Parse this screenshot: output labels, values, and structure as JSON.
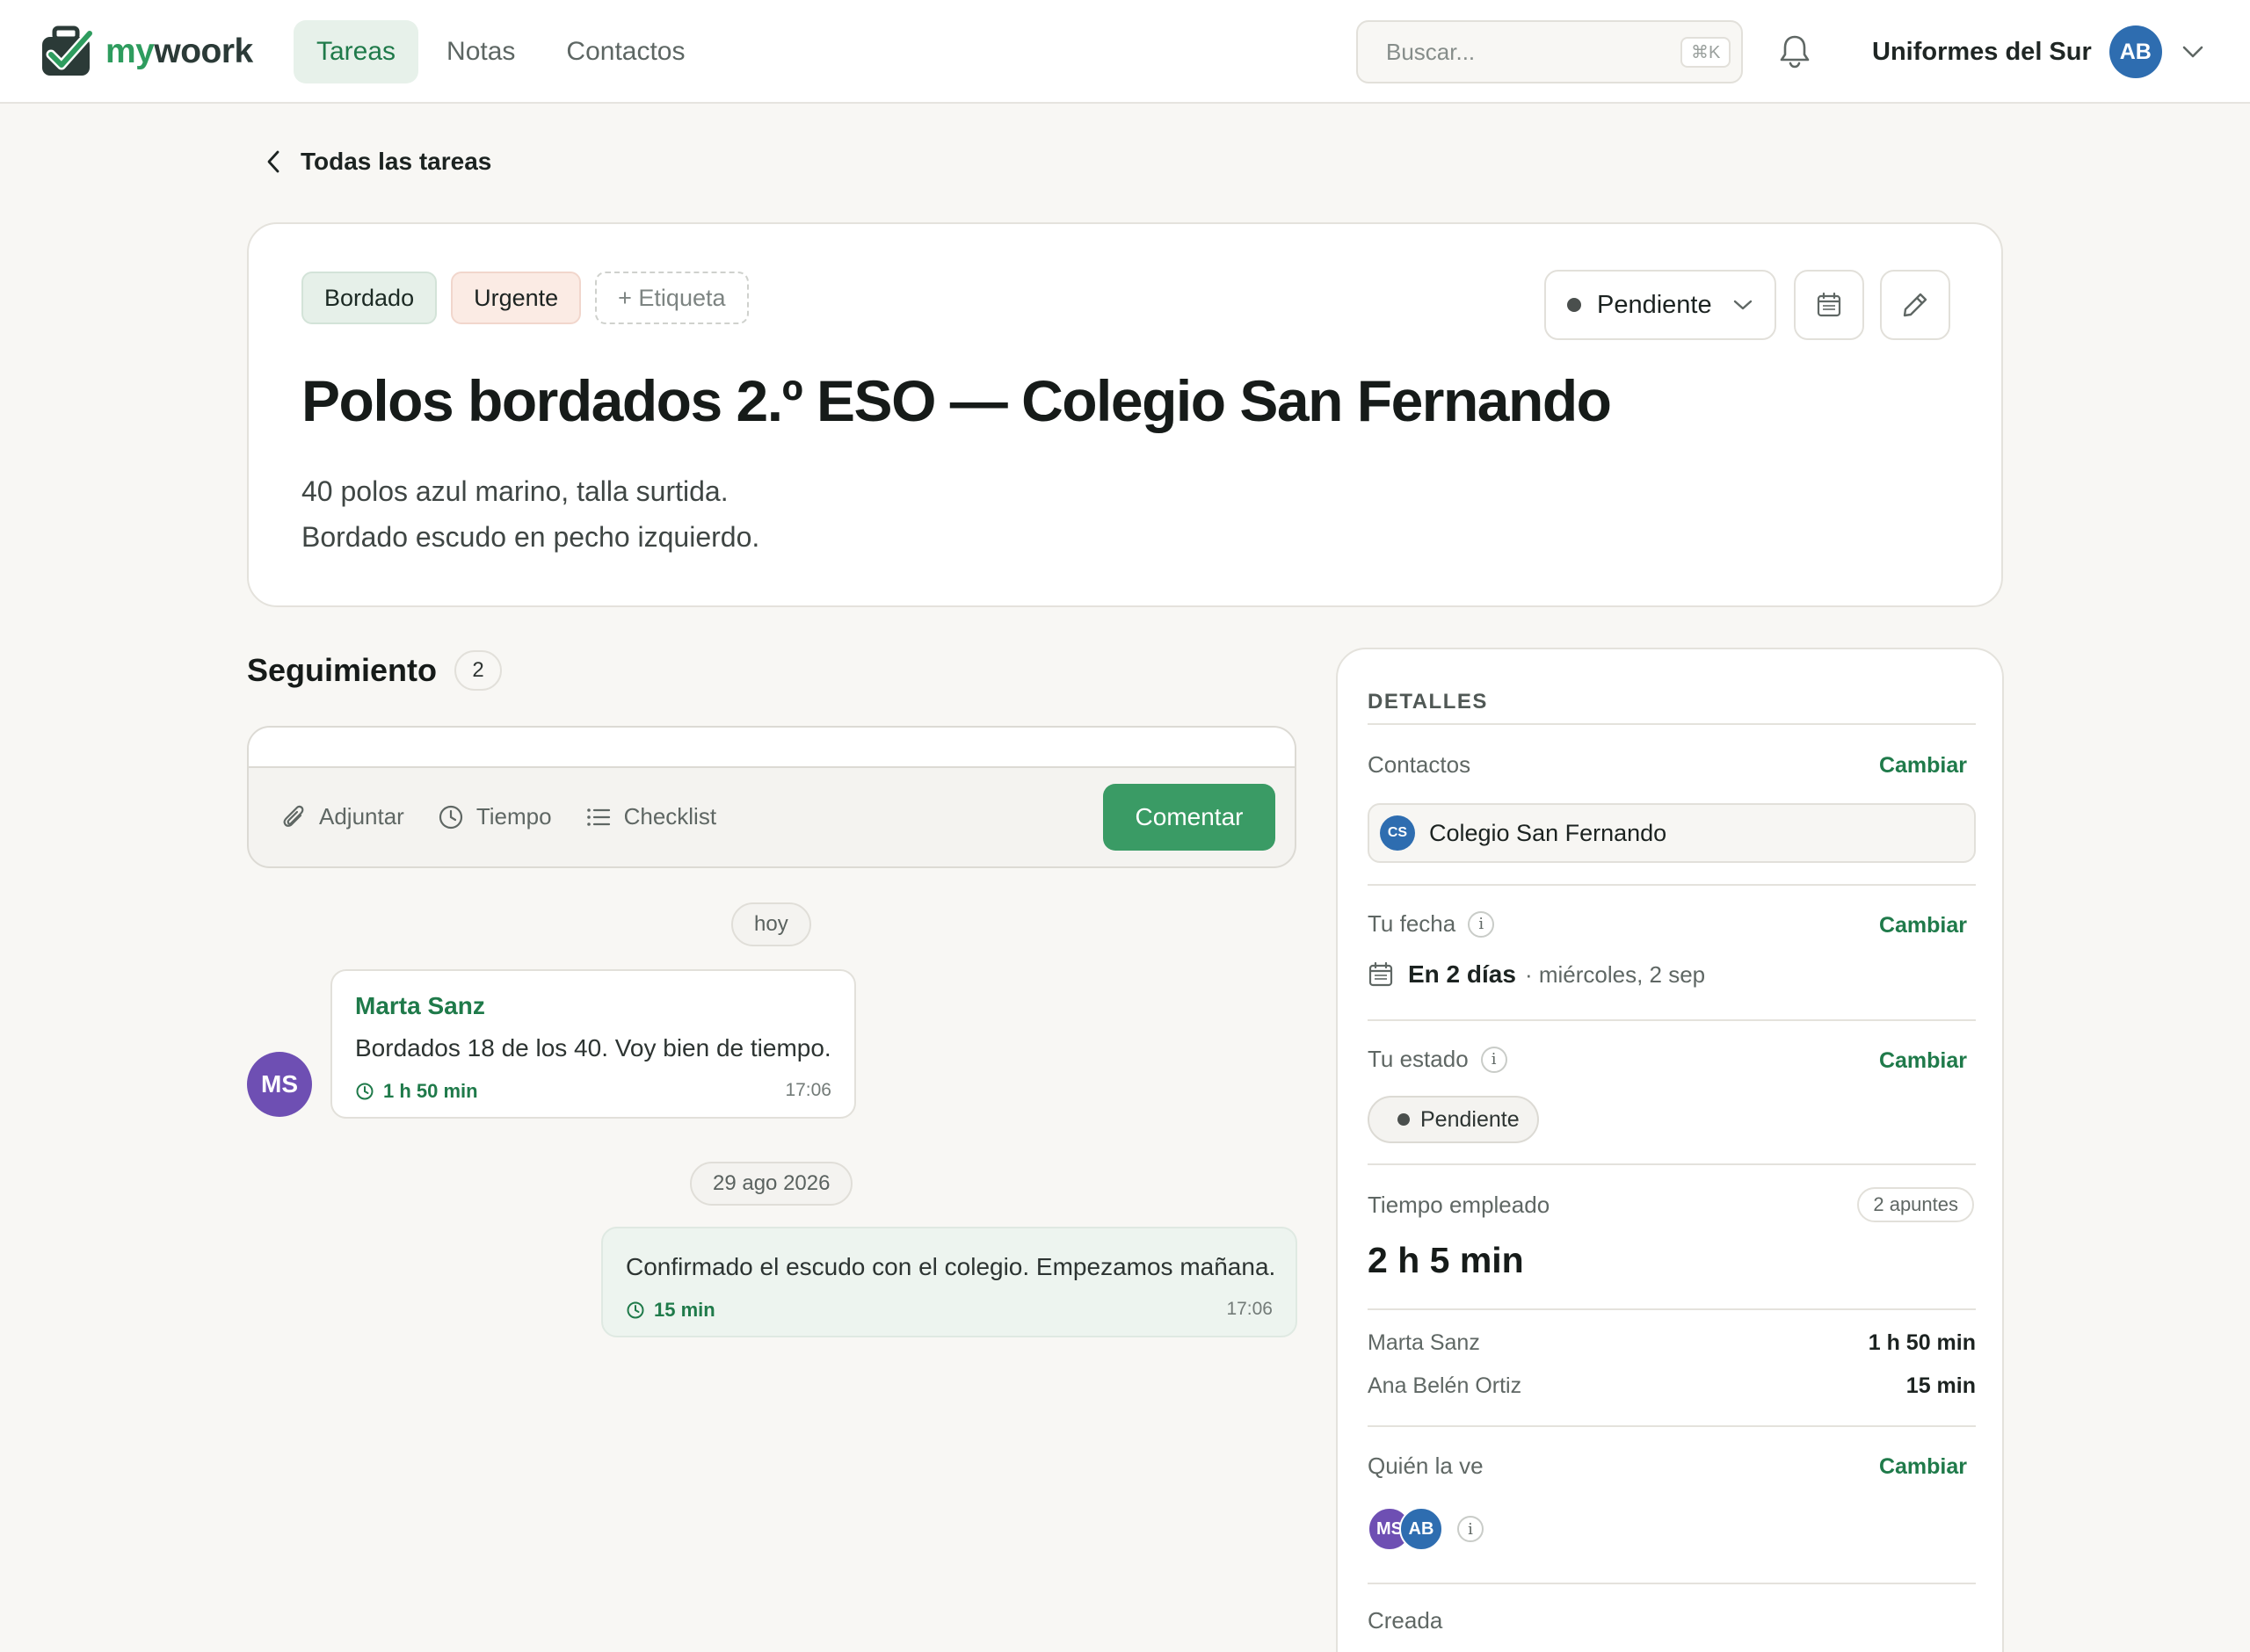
{
  "brand": {
    "name_part1": "my",
    "name_part2": "woork",
    "accent": "#3a9b65"
  },
  "nav": {
    "tabs": [
      {
        "label": "Tareas",
        "active": true
      },
      {
        "label": "Notas",
        "active": false
      },
      {
        "label": "Contactos",
        "active": false
      }
    ]
  },
  "search": {
    "placeholder": "Buscar...",
    "shortcut": "⌘K"
  },
  "account": {
    "name": "Uniformes del Sur",
    "initials": "AB"
  },
  "back": {
    "label": "Todas las tareas"
  },
  "task": {
    "tags": [
      "Bordado",
      "Urgente"
    ],
    "add_tag_label": "+ Etiqueta",
    "status": "Pendiente",
    "title": "Polos bordados 2.º ESO — Colegio San Fernando",
    "description_lines": [
      "40 polos azul marino, talla surtida.",
      "Bordado escudo en pecho izquierdo."
    ]
  },
  "followup": {
    "title": "Seguimiento",
    "count": "2",
    "composer": {
      "placeholder": "",
      "tools": [
        "Adjuntar",
        "Tiempo",
        "Checklist"
      ],
      "submit_label": "Comentar"
    },
    "groups": [
      {
        "date_label": "hoy",
        "messages": [
          {
            "author": "Marta Sanz",
            "initials": "MS",
            "text": "Bordados 18 de los 40. Voy bien de tiempo.",
            "duration": "1 h 50 min",
            "time": "17:06"
          }
        ]
      },
      {
        "date_label": "29 ago 2026",
        "messages": [
          {
            "author": "",
            "own": true,
            "text": "Confirmado el escudo con el colegio. Empezamos mañana.",
            "duration": "15 min",
            "time": "17:06"
          }
        ]
      }
    ]
  },
  "details": {
    "heading": "DETALLES",
    "change_label": "Cambiar",
    "contacts": {
      "label": "Contactos",
      "contact_name": "Colegio San Fernando",
      "contact_initials": "CS"
    },
    "date": {
      "label": "Tu fecha",
      "relative": "En 2 días",
      "absolute": "· miércoles, 2 sep"
    },
    "state": {
      "label": "Tu estado",
      "value": "Pendiente"
    },
    "time_spent": {
      "label": "Tiempo empleado",
      "notes_badge": "2 apuntes",
      "total": "2 h 5 min",
      "breakdown": [
        {
          "who": "Marta Sanz",
          "amount": "1 h 50 min"
        },
        {
          "who": "Ana Belén Ortiz",
          "amount": "15 min"
        }
      ]
    },
    "visibility": {
      "label": "Quién la ve",
      "viewers": [
        "MS",
        "AB"
      ]
    },
    "created": {
      "label": "Creada"
    }
  }
}
